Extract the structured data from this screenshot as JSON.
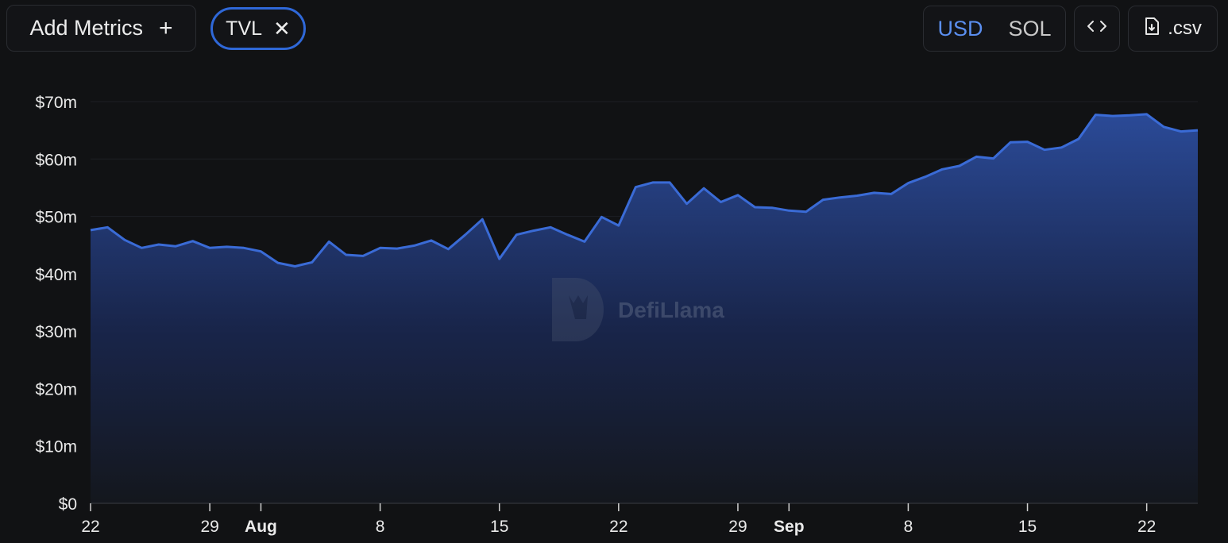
{
  "toolbar": {
    "add_metrics_label": "Add Metrics",
    "add_icon": "plus-icon",
    "metric_chip_label": "TVL",
    "remove_icon": "close-icon",
    "currency_options": [
      "USD",
      "SOL"
    ],
    "currency_selected": "USD",
    "embed_icon": "code-icon",
    "csv_label": ".csv",
    "csv_icon": "file-download-icon"
  },
  "watermark": {
    "text": "DefiLlama",
    "icon": "llama-logo-icon"
  },
  "colors": {
    "accent": "#3b6ee0",
    "line": "#3a6bd6",
    "background": "#111214",
    "active_text": "#5b8ff0"
  },
  "chart_data": {
    "type": "area",
    "title": "",
    "xlabel": "",
    "ylabel": "",
    "ylim": [
      0,
      70
    ],
    "y_ticks": [
      "$0",
      "$10m",
      "$20m",
      "$30m",
      "$40m",
      "$50m",
      "$60m",
      "$70m"
    ],
    "x_ticks": [
      {
        "label": "22",
        "date": "2024-07-22",
        "bold": false
      },
      {
        "label": "29",
        "date": "2024-07-29",
        "bold": false
      },
      {
        "label": "Aug",
        "date": "2024-08-01",
        "bold": true
      },
      {
        "label": "8",
        "date": "2024-08-08",
        "bold": false
      },
      {
        "label": "15",
        "date": "2024-08-15",
        "bold": false
      },
      {
        "label": "22",
        "date": "2024-08-22",
        "bold": false
      },
      {
        "label": "29",
        "date": "2024-08-29",
        "bold": false
      },
      {
        "label": "Sep",
        "date": "2024-09-01",
        "bold": true
      },
      {
        "label": "8",
        "date": "2024-09-08",
        "bold": false
      },
      {
        "label": "15",
        "date": "2024-09-15",
        "bold": false
      },
      {
        "label": "22",
        "date": "2024-09-22",
        "bold": false
      }
    ],
    "series": [
      {
        "x": [
          "2024-07-22",
          "2024-07-23",
          "2024-07-24",
          "2024-07-25",
          "2024-07-26",
          "2024-07-27",
          "2024-07-28",
          "2024-07-29",
          "2024-07-30",
          "2024-07-31",
          "2024-08-01",
          "2024-08-02",
          "2024-08-03",
          "2024-08-04",
          "2024-08-05",
          "2024-08-06",
          "2024-08-07",
          "2024-08-08",
          "2024-08-09",
          "2024-08-10",
          "2024-08-11",
          "2024-08-12",
          "2024-08-13",
          "2024-08-14",
          "2024-08-15",
          "2024-08-16",
          "2024-08-17",
          "2024-08-18",
          "2024-08-19",
          "2024-08-20",
          "2024-08-21",
          "2024-08-22",
          "2024-08-23",
          "2024-08-24",
          "2024-08-25",
          "2024-08-26",
          "2024-08-27",
          "2024-08-28",
          "2024-08-29",
          "2024-08-30",
          "2024-08-31",
          "2024-09-01",
          "2024-09-02",
          "2024-09-03",
          "2024-09-04",
          "2024-09-05",
          "2024-09-06",
          "2024-09-07",
          "2024-09-08",
          "2024-09-09",
          "2024-09-10",
          "2024-09-11",
          "2024-09-12",
          "2024-09-13",
          "2024-09-14",
          "2024-09-15",
          "2024-09-16",
          "2024-09-17",
          "2024-09-18",
          "2024-09-19",
          "2024-09-20",
          "2024-09-21",
          "2024-09-22",
          "2024-09-23",
          "2024-09-24",
          "2024-09-25"
        ],
        "values": [
          47.6,
          48.1,
          45.9,
          44.5,
          45.1,
          44.8,
          45.7,
          44.5,
          44.7,
          44.5,
          43.9,
          41.9,
          41.3,
          42.0,
          45.6,
          43.3,
          43.1,
          44.5,
          44.4,
          44.9,
          45.8,
          44.3,
          46.8,
          49.5,
          42.6,
          46.8,
          47.5,
          48.1,
          46.8,
          45.6,
          49.9,
          48.4,
          55.1,
          55.9,
          55.9,
          52.2,
          54.9,
          52.5,
          53.7,
          51.6,
          51.5,
          51.0,
          50.8,
          52.9,
          53.3,
          53.6,
          54.1,
          53.9,
          55.8,
          56.9,
          58.2,
          58.8,
          60.4,
          60.1,
          62.9,
          63.0,
          61.6,
          62.0,
          63.5,
          67.7,
          67.5,
          67.6,
          67.8,
          65.6,
          64.8,
          65.0
        ]
      }
    ],
    "grid": true,
    "legend": "none"
  }
}
